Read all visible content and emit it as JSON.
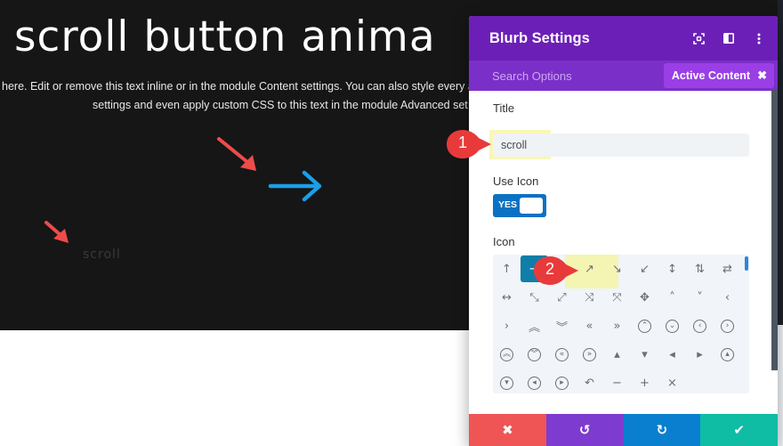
{
  "page": {
    "heading": "scroll button anima",
    "body_line1": "here. Edit or remove this text inline or in the module Content settings. You can also style every a",
    "body_line2": "settings and even apply custom CSS to this text in the module Advanced set",
    "blurb_icon": "arrow-right-icon",
    "blurb_title": "scroll",
    "colors": {
      "background": "#161616",
      "blurb_icon": "#1a9fe8",
      "annotation": "#ef4b4b"
    }
  },
  "modal": {
    "title": "Blurb Settings",
    "header_icons": [
      "expand-icon",
      "sidebar-layout-icon",
      "more-options-icon"
    ],
    "search_placeholder": "Search Options",
    "active_filter_label": "Active Content",
    "active_filter_close": "✖",
    "fields": {
      "title_label": "Title",
      "title_value": "scroll",
      "use_icon_label": "Use Icon",
      "use_icon_value": "YES",
      "icon_label": "Icon"
    },
    "icon_picker": {
      "selected_index": 1,
      "icons": [
        {
          "name": "arrow-up",
          "glyph": "↑"
        },
        {
          "name": "arrow-right",
          "glyph": "→"
        },
        {
          "name": "arrow-up-left",
          "glyph": "↖"
        },
        {
          "name": "arrow-up-right",
          "glyph": "↗"
        },
        {
          "name": "arrow-down-right",
          "glyph": "↘"
        },
        {
          "name": "arrow-down-left",
          "glyph": "↙"
        },
        {
          "name": "arrow-up-down",
          "glyph": "↕"
        },
        {
          "name": "arrows-vertical-swap",
          "glyph": "⇅"
        },
        {
          "name": "arrows-horizontal-swap",
          "glyph": "⇄"
        },
        {
          "name": "arrow-left-right",
          "glyph": "↔"
        },
        {
          "name": "arrow-resize-diagonal-1",
          "glyph": "⤡"
        },
        {
          "name": "arrow-resize-diagonal-2",
          "glyph": "⤢"
        },
        {
          "name": "arrows-shrink",
          "glyph": "⤨"
        },
        {
          "name": "arrows-expand",
          "glyph": "⤧"
        },
        {
          "name": "move",
          "glyph": "✥"
        },
        {
          "name": "chevron-up",
          "glyph": "˄"
        },
        {
          "name": "chevron-down",
          "glyph": "˅"
        },
        {
          "name": "chevron-left",
          "glyph": "‹"
        },
        {
          "name": "chevron-right",
          "glyph": "›"
        },
        {
          "name": "double-chevron-up",
          "glyph": "︽"
        },
        {
          "name": "double-chevron-down",
          "glyph": "︾"
        },
        {
          "name": "double-chevron-left",
          "glyph": "«"
        },
        {
          "name": "double-chevron-right",
          "glyph": "»"
        },
        {
          "name": "circle-chevron-up",
          "glyph": "⌃"
        },
        {
          "name": "circle-chevron-down",
          "glyph": "⌄"
        },
        {
          "name": "circle-chevron-left",
          "glyph": "‹"
        },
        {
          "name": "circle-chevron-right",
          "glyph": "›"
        },
        {
          "name": "circle-double-chevron-up",
          "glyph": "︽"
        },
        {
          "name": "circle-double-chevron-down",
          "glyph": "︾"
        },
        {
          "name": "circle-double-chevron-left",
          "glyph": "«"
        },
        {
          "name": "circle-double-chevron-right",
          "glyph": "»"
        },
        {
          "name": "triangle-up",
          "glyph": "▴"
        },
        {
          "name": "triangle-down",
          "glyph": "▾"
        },
        {
          "name": "triangle-left",
          "glyph": "◂"
        },
        {
          "name": "triangle-right",
          "glyph": "▸"
        },
        {
          "name": "circle-triangle-up",
          "glyph": "▴"
        },
        {
          "name": "circle-triangle-down",
          "glyph": "▾"
        },
        {
          "name": "circle-triangle-left",
          "glyph": "◂"
        },
        {
          "name": "circle-triangle-right",
          "glyph": "▸"
        },
        {
          "name": "undo-arrow",
          "glyph": "↶"
        },
        {
          "name": "minus",
          "glyph": "−"
        },
        {
          "name": "plus",
          "glyph": "+"
        },
        {
          "name": "close",
          "glyph": "×"
        }
      ],
      "circled": [
        23,
        24,
        25,
        26,
        27,
        28,
        29,
        30,
        35,
        36,
        37,
        38
      ]
    },
    "footer": {
      "cancel_glyph": "✖",
      "undo_glyph": "↺",
      "redo_glyph": "↻",
      "save_glyph": "✔",
      "colors": {
        "cancel": "#ef5555",
        "undo": "#7e3bd0",
        "redo": "#0b7fcf",
        "save": "#0fbda5"
      }
    },
    "colors": {
      "header": "#6c1fb7",
      "search_bar": "#7b2fc9",
      "active_filter": "#9a3ee6",
      "toggle": "#0c71c3",
      "selected_icon": "#0f7ea8"
    }
  },
  "callouts": [
    {
      "label": "1"
    },
    {
      "label": "2"
    }
  ]
}
